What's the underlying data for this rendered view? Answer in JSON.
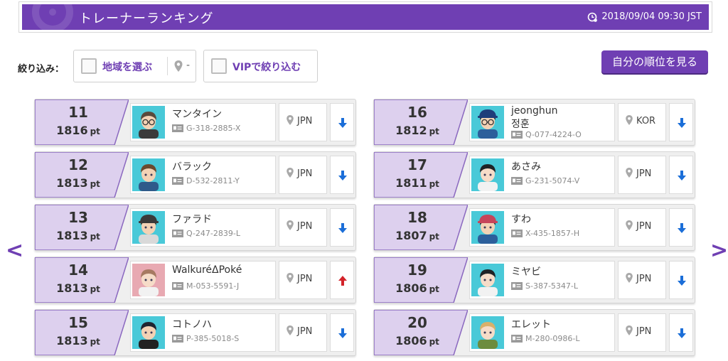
{
  "header": {
    "title": "トレーナーランキング",
    "datetime": "2018/09/04 09:30 JST",
    "accent_color": "#6f3fb3"
  },
  "filters": {
    "label": "絞り込み：",
    "region_label": "地域を選ぶ",
    "region_value": "-",
    "vip_label": "VIPで絞り込む"
  },
  "my_rank_button": "自分の順位を見る",
  "nav": {
    "prev": "<",
    "next": ">"
  },
  "pt_unit": "pt",
  "rankings": [
    {
      "rank": "11",
      "points": "1816",
      "name": "マンタイン",
      "name2": "",
      "id": "G-318-2885-X",
      "country": "JPN",
      "trend": "down",
      "avatar": "glasses-male"
    },
    {
      "rank": "12",
      "points": "1813",
      "name": "バラック",
      "name2": "",
      "id": "D-532-2811-Y",
      "country": "JPN",
      "trend": "down",
      "avatar": "brown-male"
    },
    {
      "rank": "13",
      "points": "1813",
      "name": "ファラド",
      "name2": "",
      "id": "Q-247-2839-L",
      "country": "JPN",
      "trend": "down",
      "avatar": "cap-male"
    },
    {
      "rank": "14",
      "points": "1813",
      "name": "WalkuréΔPoké",
      "name2": "",
      "id": "M-053-5591-J",
      "country": "JPN",
      "trend": "up",
      "avatar": "pink-female"
    },
    {
      "rank": "15",
      "points": "1813",
      "name": "コトノハ",
      "name2": "",
      "id": "P-385-5018-S",
      "country": "JPN",
      "trend": "down",
      "avatar": "dark-male"
    },
    {
      "rank": "16",
      "points": "1812",
      "name": "jeonghun",
      "name2": "정훈",
      "id": "Q-077-4224-O",
      "country": "KOR",
      "trend": "down",
      "avatar": "cap-glasses-male"
    },
    {
      "rank": "17",
      "points": "1811",
      "name": "あさみ",
      "name2": "",
      "id": "G-231-5074-V",
      "country": "JPN",
      "trend": "down",
      "avatar": "dark-female"
    },
    {
      "rank": "18",
      "points": "1807",
      "name": "すわ",
      "name2": "",
      "id": "X-435-1857-H",
      "country": "JPN",
      "trend": "down",
      "avatar": "hat-male"
    },
    {
      "rank": "19",
      "points": "1806",
      "name": "ミヤビ",
      "name2": "",
      "id": "S-387-5347-L",
      "country": "JPN",
      "trend": "down",
      "avatar": "dark-female"
    },
    {
      "rank": "20",
      "points": "1806",
      "name": "エレット",
      "name2": "",
      "id": "M-280-0986-L",
      "country": "JPN",
      "trend": "down",
      "avatar": "blonde-female"
    }
  ]
}
